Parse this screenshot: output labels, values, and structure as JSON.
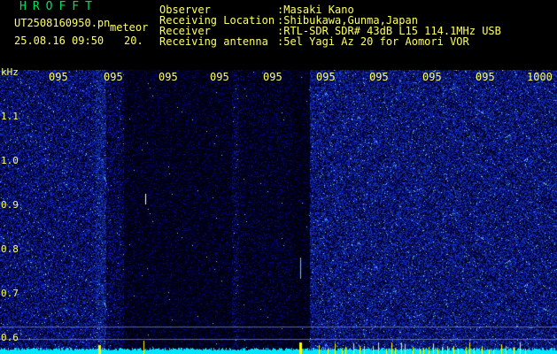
{
  "header": {
    "app_title": "HROFFT",
    "filename": "UT2508160950.pn",
    "tag": "meteor",
    "date_time": "25.08.16 09:50",
    "seconds": "20.",
    "fields": [
      {
        "label": "Observer",
        "value": ":Masaki Kano"
      },
      {
        "label": "Receiving Location",
        "value": ":Shibukawa,Gunma,Japan"
      },
      {
        "label": "Receiver",
        "value": ":RTL-SDR SDR# 43dB L15 114.1MHz USB"
      },
      {
        "label": "Receiving antenna",
        "value": ":5el Yagi Az 20 for Aomori VOR"
      }
    ]
  },
  "axes": {
    "y_unit": "kHz",
    "y_ticks": [
      "1.1",
      "1.0",
      "0.9",
      "0.8",
      "0.7",
      "0.6"
    ],
    "x_ticks": [
      "095",
      "095",
      "095",
      "095",
      "095",
      "095",
      "095",
      "095",
      "095",
      "1000"
    ]
  },
  "colors": {
    "label": "#ffff66",
    "title": "#00e060",
    "noise": "#1a2a9a",
    "baseline": "#00e5ff",
    "echo": "#ffff00"
  }
}
